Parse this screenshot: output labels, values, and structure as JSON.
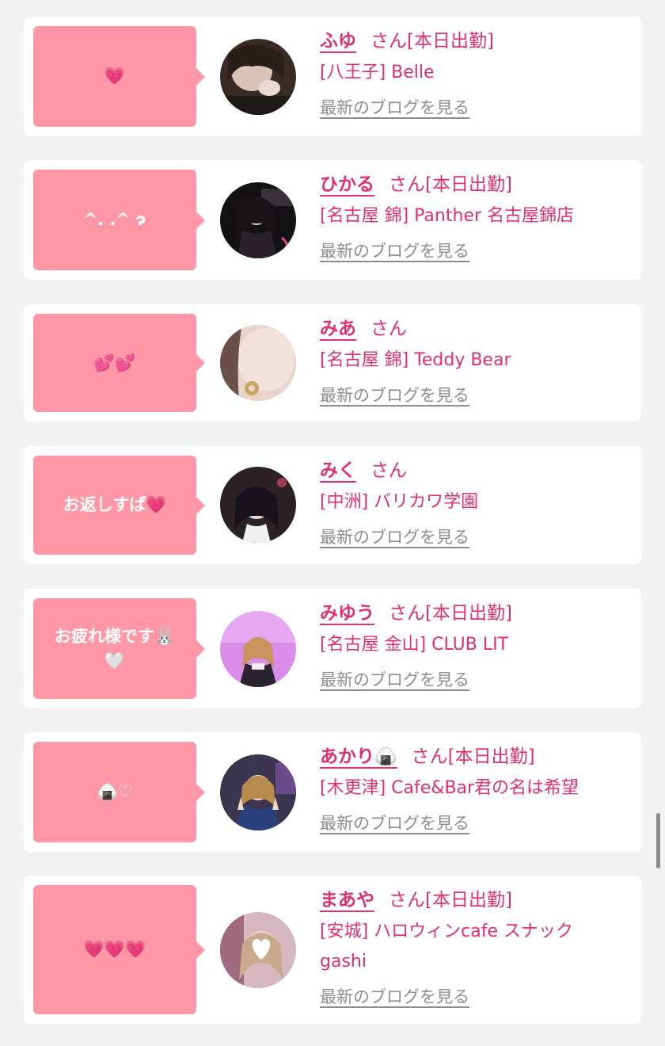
{
  "cards": [
    {
      "message": "💗",
      "name": "ふゆ",
      "suffix": "さん[本日出勤]",
      "shop": "[八王子] Belle",
      "blog_link": "最新のブログを見る",
      "avatar_icon": "profile-photo-icon"
    },
    {
      "message": "^. .^ ɂ",
      "name": "ひかる",
      "suffix": "さん[本日出勤]",
      "shop": "[名古屋 錦] Panther 名古屋錦店",
      "blog_link": "最新のブログを見る",
      "avatar_icon": "profile-photo-icon"
    },
    {
      "message": "💕💕",
      "name": "みあ",
      "suffix": "さん",
      "shop": "[名古屋 錦] Teddy Bear",
      "blog_link": "最新のブログを見る",
      "avatar_icon": "profile-photo-icon"
    },
    {
      "message": "お返しすぱ💗",
      "name": "みく",
      "suffix": "さん",
      "shop": "[中洲] バリカワ学園",
      "blog_link": "最新のブログを見る",
      "avatar_icon": "profile-photo-icon"
    },
    {
      "message": "お疲れ様です🐰\n🤍",
      "name": "みゆう",
      "suffix": "さん[本日出勤]",
      "shop": "[名古屋 金山] CLUB LIT",
      "blog_link": "最新のブログを見る",
      "avatar_icon": "profile-photo-icon"
    },
    {
      "message": "🍙♡",
      "name": "あかり🍙",
      "suffix": "さん[本日出勤]",
      "shop": "[木更津] Cafe&Bar君の名は希望",
      "blog_link": "最新のブログを見る",
      "avatar_icon": "profile-photo-icon"
    },
    {
      "message": "💗💗💗",
      "name": "まあや",
      "suffix": "さん[本日出勤]",
      "shop": "[安城] ハロウィンcafe スナックgashi",
      "blog_link": "最新のブログを見る",
      "avatar_icon": "profile-photo-icon"
    }
  ],
  "colors": {
    "accent": "#e0306f",
    "bubble": "#ff97a7",
    "link_gray": "#8d8d8d",
    "background": "#f2f2f3"
  }
}
